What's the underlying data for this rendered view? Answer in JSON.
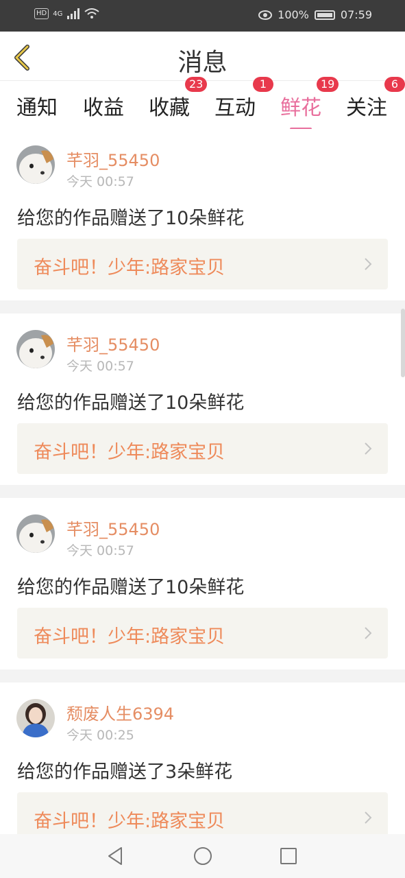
{
  "status_bar": {
    "hd": "HD",
    "network": "4G",
    "battery_text": "100%",
    "time": "07:59"
  },
  "header": {
    "title": "消息",
    "back_icon": "chevron-left-icon"
  },
  "tabs": [
    {
      "label": "通知",
      "badge": ""
    },
    {
      "label": "收益",
      "badge": ""
    },
    {
      "label": "收藏",
      "badge": "23"
    },
    {
      "label": "互动",
      "badge": "1"
    },
    {
      "label": "鲜花",
      "badge": "19",
      "active": true
    },
    {
      "label": "关注",
      "badge": "6"
    }
  ],
  "feed": [
    {
      "username": "芊羽_55450",
      "time": "今天 00:57",
      "message": "给您的作品赠送了10朵鲜花",
      "work": "奋斗吧！少年:路家宝贝",
      "avatar": "dog-avatar"
    },
    {
      "username": "芊羽_55450",
      "time": "今天 00:57",
      "message": "给您的作品赠送了10朵鲜花",
      "work": "奋斗吧！少年:路家宝贝",
      "avatar": "dog-avatar"
    },
    {
      "username": "芊羽_55450",
      "time": "今天 00:57",
      "message": "给您的作品赠送了10朵鲜花",
      "work": "奋斗吧！少年:路家宝贝",
      "avatar": "dog-avatar"
    },
    {
      "username": "颓废人生6394",
      "time": "今天 00:25",
      "message": "给您的作品赠送了3朵鲜花",
      "work": "奋斗吧！少年:路家宝贝",
      "avatar": "girl-avatar"
    }
  ],
  "colors": {
    "accent_pink": "#e86e9c",
    "username_orange": "#e58d63",
    "work_orange": "#ee8a5a",
    "badge_red": "#e8394c",
    "back_yellow": "#e9c94a"
  }
}
